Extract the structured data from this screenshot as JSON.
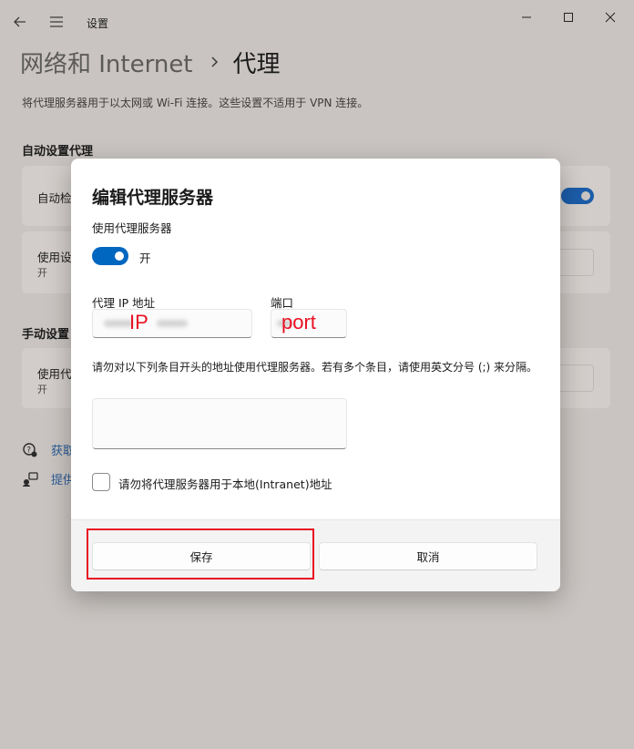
{
  "window": {
    "title": "设置"
  },
  "breadcrumb": {
    "parent": "网络和 Internet",
    "current": "代理"
  },
  "page": {
    "description": "将代理服务器用于以太网或 Wi-Fi 连接。这些设置不适用于 VPN 连接。"
  },
  "background": {
    "auto_section": "自动设置代理",
    "auto_detect_label": "自动检",
    "use_script_label": "使用设",
    "use_script_state": "开",
    "manual_section": "手动设置",
    "manual_use_label": "使用代",
    "manual_use_state": "开",
    "help_link": "获取",
    "feedback_link": "提供"
  },
  "dialog": {
    "title": "编辑代理服务器",
    "use_proxy_label": "使用代理服务器",
    "toggle_state": "开",
    "ip_label": "代理 IP 地址",
    "ip_value": "IP",
    "port_label": "端口",
    "port_value": "port",
    "exceptions_desc": "请勿对以下列条目开头的地址使用代理服务器。若有多个条目，请使用英文分号 (;) 来分隔。",
    "exceptions_value": "",
    "local_checkbox_label": "请勿将代理服务器用于本地(Intranet)地址",
    "save_button": "保存",
    "cancel_button": "取消"
  },
  "colors": {
    "accent": "#0067c0",
    "annotation": "#e81123"
  }
}
